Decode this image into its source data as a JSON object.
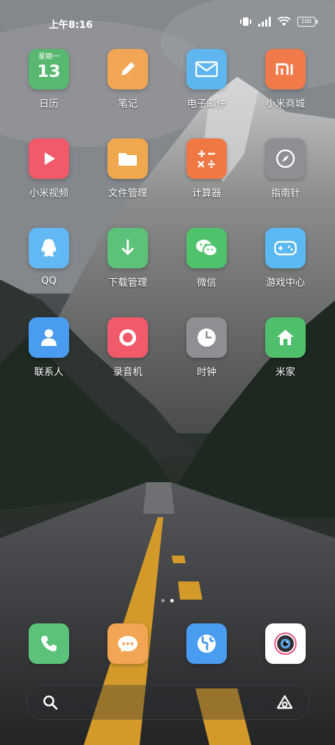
{
  "status_bar": {
    "time": "上午8:16",
    "battery": "100"
  },
  "apps": [
    {
      "label": "日历",
      "icon": "calendar-icon",
      "color": "#58b86f",
      "cal_weekday": "星期一",
      "cal_day": "13"
    },
    {
      "label": "笔记",
      "icon": "pencil-icon",
      "color": "#f2a654"
    },
    {
      "label": "电子邮件",
      "icon": "mail-icon",
      "color": "#5fb6ee"
    },
    {
      "label": "小米商城",
      "icon": "mi-store-icon",
      "color": "#f07a4a"
    },
    {
      "label": "小米视频",
      "icon": "play-icon",
      "color": "#f05a6a"
    },
    {
      "label": "文件管理",
      "icon": "folder-icon",
      "color": "#f0a84e"
    },
    {
      "label": "计算器",
      "icon": "calculator-icon",
      "color": "#f07844"
    },
    {
      "label": "指南针",
      "icon": "compass-icon",
      "color": "#8e8e93"
    },
    {
      "label": "QQ",
      "icon": "qq-penguin-icon",
      "color": "#62b8f3"
    },
    {
      "label": "下载管理",
      "icon": "download-icon",
      "color": "#5cc27a"
    },
    {
      "label": "微信",
      "icon": "wechat-icon",
      "color": "#4fc36b"
    },
    {
      "label": "游戏中心",
      "icon": "gamepad-icon",
      "color": "#5ab8f2"
    },
    {
      "label": "联系人",
      "icon": "contact-icon",
      "color": "#4a9cf0"
    },
    {
      "label": "录音机",
      "icon": "recorder-icon",
      "color": "#f05a6a"
    },
    {
      "label": "时钟",
      "icon": "clock-icon",
      "color": "#8e8e93"
    },
    {
      "label": "米家",
      "icon": "home-icon",
      "color": "#4fbf6c"
    }
  ],
  "dock": [
    {
      "name": "phone",
      "icon": "phone-icon",
      "color": "#5cc27a"
    },
    {
      "name": "messages",
      "icon": "message-icon",
      "color": "#f2a654"
    },
    {
      "name": "browser",
      "icon": "globe-icon",
      "color": "#4a9cf0"
    },
    {
      "name": "camera",
      "icon": "camera-icon",
      "color": "#ffffff"
    }
  ],
  "page_indicator": {
    "pages": 2,
    "current": 2
  }
}
